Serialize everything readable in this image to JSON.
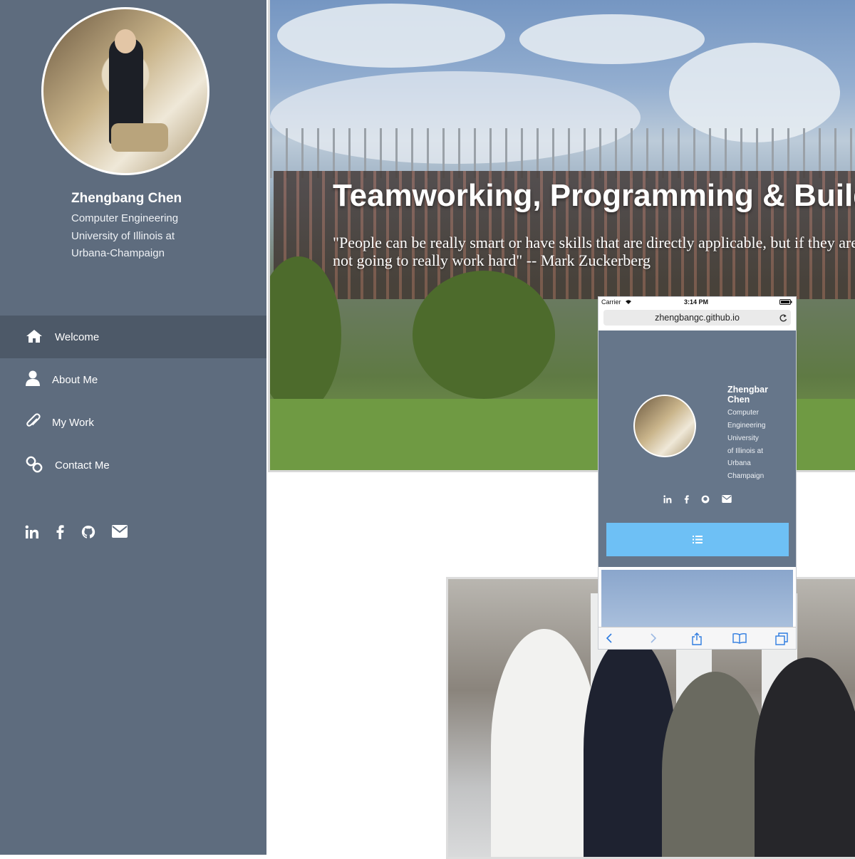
{
  "sidebar": {
    "profile": {
      "name": "Zhengbang Chen",
      "lines": [
        "Computer Engineering",
        "University of Illinois at",
        "Urbana-Champaign"
      ]
    },
    "nav": [
      {
        "label": "Welcome",
        "icon": "home-icon",
        "active": true
      },
      {
        "label": "About Me",
        "icon": "user-icon",
        "active": false
      },
      {
        "label": "My Work",
        "icon": "paperclip-icon",
        "active": false
      },
      {
        "label": "Contact Me",
        "icon": "link-icon",
        "active": false
      }
    ],
    "social": [
      "linkedin-icon",
      "facebook-icon",
      "github-icon",
      "envelope-icon"
    ]
  },
  "hero": {
    "title": "Teamworking, Programming & Buildi",
    "quote": "\"People can be really smart or have skills that are directly applicable, but if they are not going to really work hard\" -- Mark Zuckerberg"
  },
  "phone": {
    "carrier": "Carrier",
    "time": "3:14 PM",
    "url": "zhengbangc.github.io",
    "name": "Zhengbar Chen",
    "lines": [
      "Computer",
      "Engineering",
      "University",
      "of Illinois at",
      "Urbana",
      "Champaign"
    ],
    "menu_icon": "list-icon"
  },
  "colors": {
    "sidebar": "#5e6c7e",
    "sidebar_active": "#4d5968",
    "phone_menu": "#6ec0f5"
  }
}
